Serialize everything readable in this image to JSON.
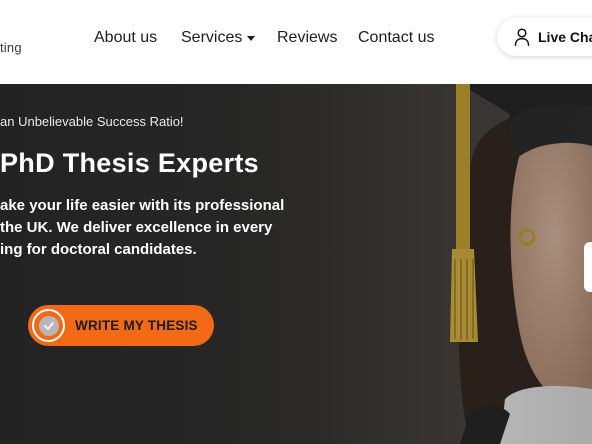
{
  "header": {
    "logo_tail": "ting",
    "nav": {
      "about": "About us",
      "services": "Services",
      "reviews": "Reviews",
      "contact": "Contact us"
    },
    "live_chat": "Live Cha"
  },
  "hero": {
    "tagline": "an Unbelievable Success Ratio!",
    "title": "PhD Thesis Experts",
    "desc_line1": "ake your life easier with its professional",
    "desc_line2": "the UK. We deliver excellence in every",
    "desc_line3": "ing for doctoral candidates.",
    "cta_label": "WRITE MY THESIS"
  },
  "colors": {
    "accent": "#f26a16",
    "hero_bg": "#232323",
    "tassel": "#c9a22a"
  }
}
